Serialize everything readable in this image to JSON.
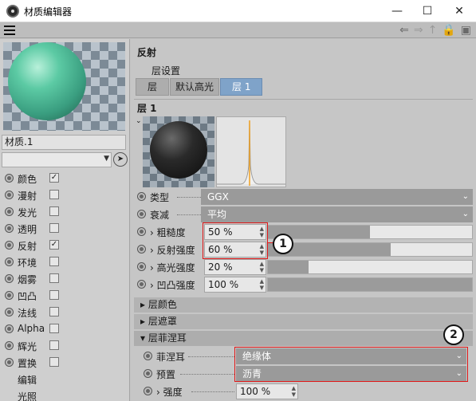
{
  "window": {
    "title": "材质编辑器",
    "min": "—",
    "max": "☐",
    "close": "✕"
  },
  "nav": [
    "⇐",
    "⇒",
    "↑",
    "🔒",
    "▣"
  ],
  "left": {
    "material_name": "材质.1",
    "channels": [
      {
        "label": "颜色",
        "checked": true
      },
      {
        "label": "漫射",
        "checked": false
      },
      {
        "label": "发光",
        "checked": false
      },
      {
        "label": "透明",
        "checked": false
      },
      {
        "label": "反射",
        "checked": true
      },
      {
        "label": "环境",
        "checked": false
      },
      {
        "label": "烟雾",
        "checked": false
      },
      {
        "label": "凹凸",
        "checked": false
      },
      {
        "label": "法线",
        "checked": false
      },
      {
        "label": "Alpha",
        "checked": false
      },
      {
        "label": "辉光",
        "checked": false
      },
      {
        "label": "置换",
        "checked": false
      },
      {
        "label": "编辑",
        "checked": null
      },
      {
        "label": "光照",
        "checked": null
      }
    ]
  },
  "right": {
    "section": "反射",
    "layer_settings": "层设置",
    "tabs": [
      "层",
      "默认高光",
      "层 1"
    ],
    "active_tab": 2,
    "layer_title": "层 1",
    "props": {
      "type": {
        "label": "类型",
        "value": "GGX"
      },
      "attenuation": {
        "label": "衰减",
        "value": "平均"
      },
      "roughness": {
        "label": "› 粗糙度",
        "value": "50 %",
        "fraction": 0.5
      },
      "reflect_strength": {
        "label": "› 反射强度",
        "value": "60 %",
        "fraction": 0.6
      },
      "specular_strength": {
        "label": "› 高光强度",
        "value": "20 %",
        "fraction": 0.2
      },
      "bump_strength": {
        "label": "› 凹凸强度",
        "value": "100 %",
        "fraction": 1.0
      }
    },
    "sections": {
      "layer_color": "▸ 层颜色",
      "layer_mask": "▸ 层遮罩",
      "layer_fresnel": "▾ 层菲涅耳"
    },
    "fresnel": {
      "fresnel": {
        "label": "菲涅耳",
        "value": "绝缘体"
      },
      "preset": {
        "label": "预置",
        "value": "沥青"
      },
      "strength": {
        "label": "› 强度",
        "value": "100 %"
      }
    },
    "callouts": [
      "1",
      "2"
    ]
  },
  "colors": {
    "active_tab": "#7fa3c9",
    "highlight": "#e01818",
    "sphere": "#5ccaa4"
  }
}
